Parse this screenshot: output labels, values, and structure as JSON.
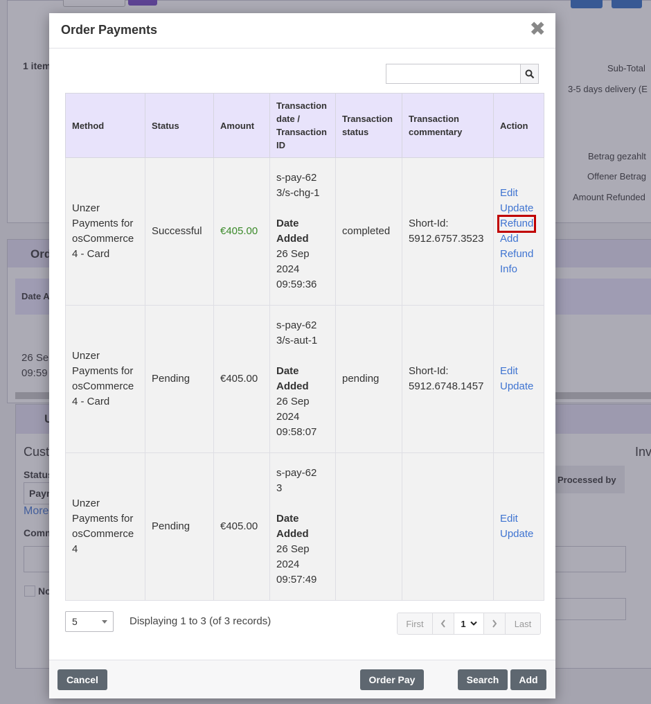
{
  "background": {
    "items_label": "1 item",
    "subtotal": "Sub-Total",
    "delivery": "3-5 days delivery (E",
    "betrag_gezahlt": "Betrag gezahlt",
    "offener_betrag": "Offener Betrag",
    "amount_refunded": "Amount Refunded",
    "orders_section": "Ord",
    "date_col": "Date A",
    "date_value_1": "26 Se",
    "date_value_2": "09:59",
    "update_section": "U",
    "customer_label": "Cust",
    "status_label": "Status",
    "status_value": "Payn",
    "more_link": "More",
    "comments_label": "Comm",
    "notify_label": "No",
    "processed_by": "Processed by",
    "inv_label": "Inv"
  },
  "modal": {
    "title": "Order Payments",
    "search": {
      "value": "",
      "placeholder": ""
    },
    "columns": {
      "method": "Method",
      "status": "Status",
      "amount": "Amount",
      "txn_date_1": "Transaction",
      "txn_date_2": "date /",
      "txn_date_3": "Transaction",
      "txn_date_4": "ID",
      "txn_status_1": "Transaction",
      "txn_status_2": "status",
      "txn_comment_1": "Transaction",
      "txn_comment_2": "commentary",
      "action": "Action"
    },
    "rows": [
      {
        "method": [
          "Unzer",
          "Payments for",
          "osCommerce",
          "4 - Card"
        ],
        "status": "Successful",
        "amount": "€405.00",
        "txn_id": [
          "s-pay-62",
          "3/s-chg-1"
        ],
        "date_label": [
          "Date",
          "Added"
        ],
        "date": [
          "26 Sep",
          "2024",
          "09:59:36"
        ],
        "txn_status": "completed",
        "comment": [
          "Short-Id:",
          "5912.6757.3523"
        ],
        "actions": [
          "Edit",
          "Update",
          "Refund",
          "Add",
          "Refund",
          "Info"
        ]
      },
      {
        "method": [
          "Unzer",
          "Payments for",
          "osCommerce",
          "4 - Card"
        ],
        "status": "Pending",
        "amount": "€405.00",
        "txn_id": [
          "s-pay-62",
          "3/s-aut-1"
        ],
        "date_label": [
          "Date",
          "Added"
        ],
        "date": [
          "26 Sep",
          "2024",
          "09:58:07"
        ],
        "txn_status": "pending",
        "comment": [
          "Short-Id:",
          "5912.6748.1457"
        ],
        "actions": [
          "Edit",
          "Update"
        ]
      },
      {
        "method": [
          "Unzer",
          "Payments for",
          "osCommerce",
          "4"
        ],
        "status": "Pending",
        "amount": "€405.00",
        "txn_id": [
          "s-pay-62",
          "3"
        ],
        "date_label": [
          "Date",
          "Added"
        ],
        "date": [
          "26 Sep",
          "2024",
          "09:57:49"
        ],
        "txn_status": "",
        "comment": [
          "",
          ""
        ],
        "actions": [
          "Edit",
          "Update"
        ]
      }
    ],
    "pager": {
      "page_size": "5",
      "info": "Displaying 1 to 3 (of 3 records)",
      "first": "First",
      "prev_icon": "chevron-left-icon",
      "current_page": "1",
      "next_icon": "chevron-right-icon",
      "last": "Last"
    },
    "footer": {
      "cancel": "Cancel",
      "order_pay": "Order Pay",
      "search": "Search",
      "add": "Add"
    }
  },
  "colors": {
    "header_bg": "#e8e3fb",
    "link": "#3f74d1",
    "amount_success": "#3b8a2a",
    "highlight": "#c00000",
    "button_bg": "#5e6770"
  }
}
